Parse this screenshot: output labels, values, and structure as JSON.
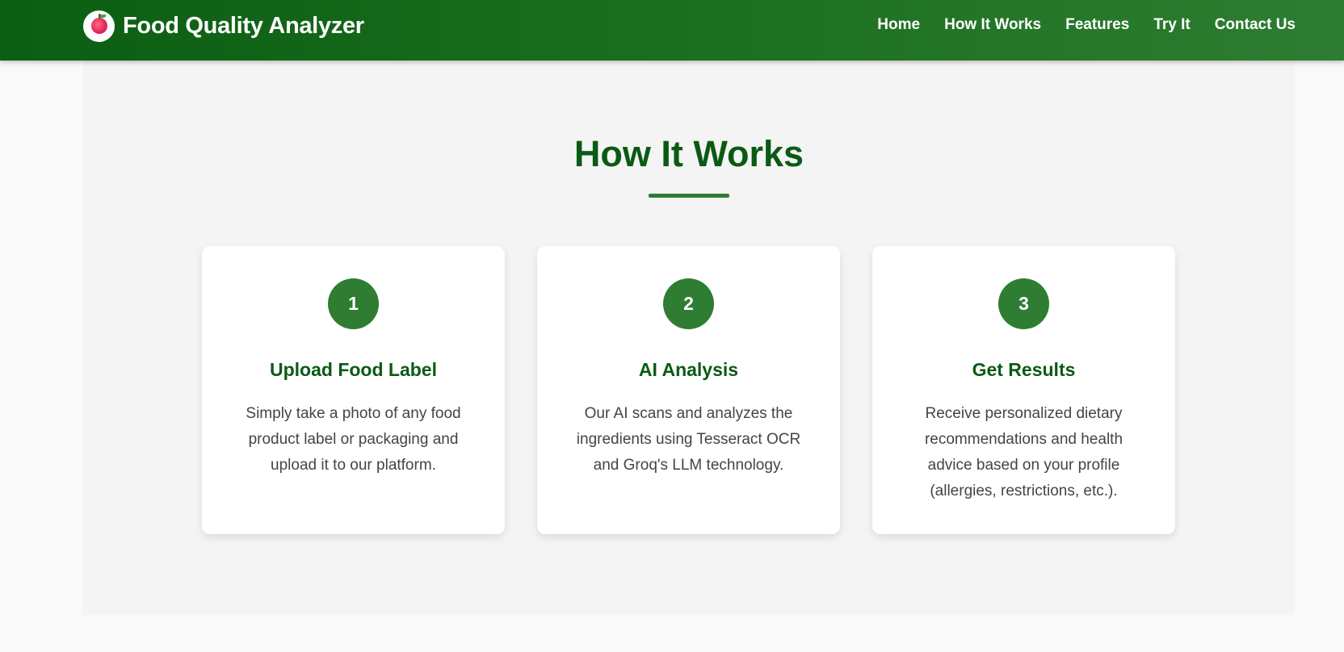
{
  "header": {
    "brand_title": "Food Quality Analyzer",
    "logo_icon": "apple-icon",
    "nav": [
      {
        "label": "Home"
      },
      {
        "label": "How It Works"
      },
      {
        "label": "Features"
      },
      {
        "label": "Try It"
      },
      {
        "label": "Contact Us"
      }
    ]
  },
  "main": {
    "section_title": "How It Works",
    "steps": [
      {
        "number": "1",
        "title": "Upload Food Label",
        "text": "Simply take a photo of any food product label or packaging and upload it to our platform."
      },
      {
        "number": "2",
        "title": "AI Analysis",
        "text": "Our AI scans and analyzes the ingredients using Tesseract OCR and Groq's LLM technology."
      },
      {
        "number": "3",
        "title": "Get Results",
        "text": "Receive personalized dietary recommendations and health advice based on your profile (allergies, restrictions, etc.)."
      }
    ]
  },
  "colors": {
    "primary_dark": "#0b5a14",
    "primary": "#2e7d32",
    "header_gradient_start": "#0b5e12",
    "header_gradient_end": "#2e7d32",
    "text": "#444444",
    "section_bg": "#f4f4f4"
  }
}
